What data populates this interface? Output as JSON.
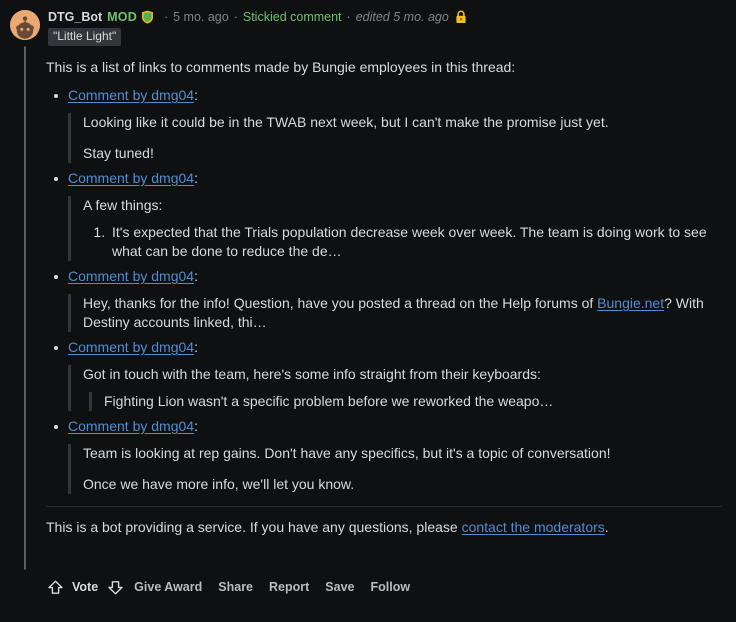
{
  "comment": {
    "avatar": "reddit-snoo-avatar",
    "author": "DTG_Bot",
    "mod_tag": "MOD",
    "mod_shield_icon": "mod-shield-icon",
    "separator": "·",
    "time_ago": "5 mo. ago",
    "stickied": "Stickied comment",
    "edited": "edited 5 mo. ago",
    "lock_icon": "lock-icon",
    "flair": "\"Little Light\"",
    "colors": {
      "background": "#0f1012",
      "text": "#d7dadc",
      "muted": "#818384",
      "link": "#4f8ed4",
      "mod_green": "#6ec36e",
      "flair_bg": "#33363a",
      "threadline": "#5c5e60",
      "quote_bar": "#343536",
      "avatar_bg": "#e8a973",
      "lock_gold": "#f2c21b"
    }
  },
  "body": {
    "intro": "This is a list of links to comments made by Bungie employees in this thread:",
    "items": [
      {
        "link_text": "Comment by dmg04",
        "link_suffix": ":",
        "quote_paragraphs": [
          "Looking like it could be in the TWAB next week, but I can't make the promise just yet.",
          "Stay tuned!"
        ]
      },
      {
        "link_text": "Comment by dmg04",
        "link_suffix": ":",
        "quote_lead": "A few things:",
        "numbered": [
          "It's expected that the Trials population decrease week over week. The team is doing work to see what can be done to reduce the de…"
        ]
      },
      {
        "link_text": "Comment by dmg04",
        "link_suffix": ":",
        "quote_rich": {
          "before": "Hey, thanks for the info! Question, have you posted a thread on the Help forums of ",
          "link": "Bungie.net",
          "after": "? With Destiny accounts linked, thi…"
        }
      },
      {
        "link_text": "Comment by dmg04",
        "link_suffix": ":",
        "quote_lead": "Got in touch with the team, here's some info straight from their keyboards:",
        "nested_quote": "Fighting Lion wasn't a specific problem before we reworked the weapo…"
      },
      {
        "link_text": "Comment by dmg04",
        "link_suffix": ":",
        "quote_paragraphs": [
          "Team is looking at rep gains. Don't have any specifics, but it's a topic of conversation!",
          "Once we have more info, we'll let you know."
        ]
      }
    ],
    "footer_note": {
      "before": "This is a bot providing a service. If you have any questions, please ",
      "link": "contact the moderators",
      "after": "."
    }
  },
  "actions": {
    "upvote_icon": "upvote-arrow-icon",
    "vote_label": "Vote",
    "downvote_icon": "downvote-arrow-icon",
    "give_award": "Give Award",
    "share": "Share",
    "report": "Report",
    "save": "Save",
    "follow": "Follow"
  }
}
